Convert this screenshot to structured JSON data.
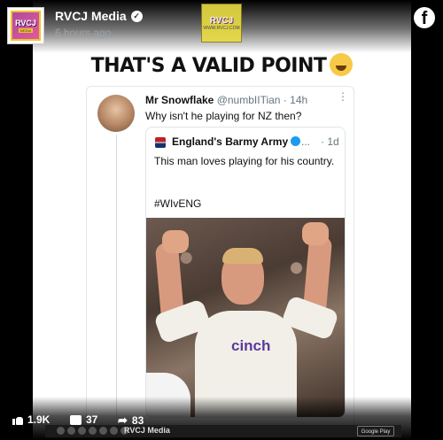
{
  "post": {
    "page_name": "RVCJ Media",
    "time": "6 hours ago",
    "avatar_text": "RVCJ",
    "avatar_sub": "MEDIA",
    "watermark_text": "RVCJ",
    "watermark_sub": "WWW.RVCJ.COM"
  },
  "headline": "THAT'S A VALID POINT",
  "tweet": {
    "name": "Mr Snowflake",
    "handle": "@numbIITian",
    "sep": "·",
    "time": "14h",
    "more": "⋮",
    "text": "Why isn't he playing for NZ then?"
  },
  "quote": {
    "name": "England's Barmy Army",
    "dots": "...",
    "time": "· 1d",
    "text": "This man loves playing for his country.",
    "hashtag": "#WIvENG",
    "photo_text": "cinch"
  },
  "reactions": {
    "likes": "1.9K",
    "comments": "37",
    "shares": "83"
  },
  "footer": {
    "brand": "RVCJ Media",
    "store": "Google Play"
  },
  "colors": {
    "background": "#000000",
    "verified_blue": "#1d9bf0",
    "watermark_yellow": "#e9dc42"
  },
  "icons": [
    "facebook-icon",
    "verified-icon",
    "laughing-emoji-icon",
    "like-icon",
    "comment-icon",
    "share-icon"
  ]
}
